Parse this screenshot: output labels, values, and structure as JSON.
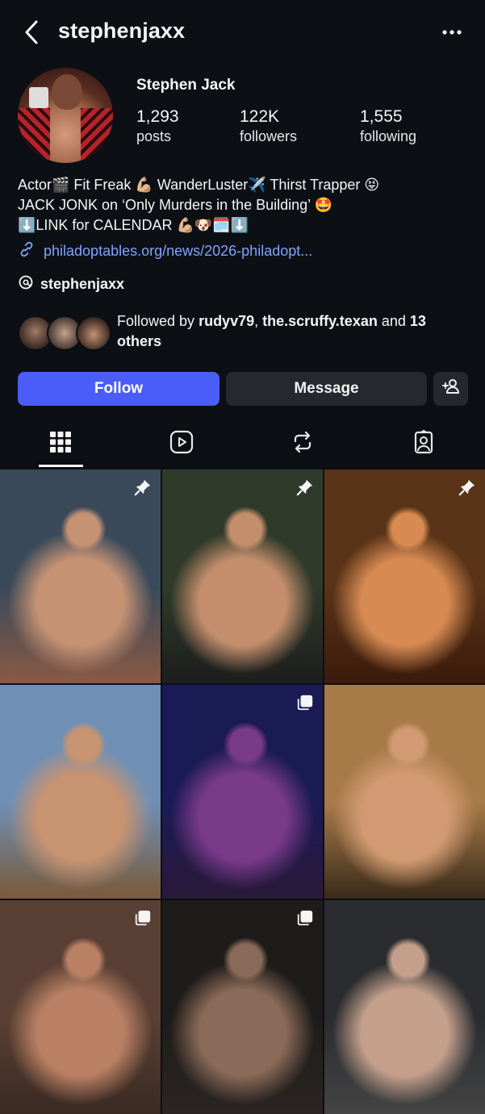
{
  "header": {
    "username": "stephenjaxx"
  },
  "profile": {
    "display_name": "Stephen Jack",
    "stats": [
      {
        "value": "1,293",
        "label": "posts"
      },
      {
        "value": "122K",
        "label": "followers"
      },
      {
        "value": "1,555",
        "label": "following"
      }
    ]
  },
  "bio": {
    "lines": [
      "Actor🎬 Fit Freak 💪🏼 WanderLuster✈️ Thirst Trapper 😝",
      "JACK JONK on ‘Only Murders in the Building’ 🤩",
      "⬇️LINK for CALENDAR 💪🏼🐶🗓️⬇️"
    ],
    "link": "philadoptables.org/news/2026-philadopt...",
    "threads_handle": "stephenjaxx"
  },
  "followed_by": {
    "prefix": "Followed by ",
    "user1": "rudyv79",
    "sep": ", ",
    "user2": "the.scruffy.texan",
    "and": " and ",
    "others": "13 others"
  },
  "actions": {
    "follow": "Follow",
    "message": "Message"
  },
  "tabs": [
    "grid-icon",
    "reels-icon",
    "reposts-icon",
    "tagged-icon"
  ],
  "posts": [
    {
      "badge": "pin-icon",
      "colors": [
        "#3a4a5a",
        "#c69274",
        "#8a5a44"
      ]
    },
    {
      "badge": "pin-icon",
      "colors": [
        "#2f3a2a",
        "#c48e6c",
        "#1d1d1d"
      ]
    },
    {
      "badge": "pin-icon",
      "colors": [
        "#5a3418",
        "#d78a52",
        "#3a1a0c"
      ]
    },
    {
      "badge": "",
      "colors": [
        "#6f8fb5",
        "#c79370",
        "#7a5a3a"
      ]
    },
    {
      "badge": "carousel-icon",
      "colors": [
        "#1a1a55",
        "#7a3a8a",
        "#2a1a3a"
      ]
    },
    {
      "badge": "",
      "colors": [
        "#a87a48",
        "#d19a72",
        "#3a2a1a"
      ]
    },
    {
      "badge": "carousel-icon",
      "colors": [
        "#5a4034",
        "#b98064",
        "#3a2a22"
      ]
    },
    {
      "badge": "carousel-icon",
      "colors": [
        "#1e1c1a",
        "#8a6a58",
        "#2a2522"
      ]
    },
    {
      "badge": "",
      "colors": [
        "#2a2c30",
        "#c4a08c",
        "#444"
      ]
    }
  ]
}
